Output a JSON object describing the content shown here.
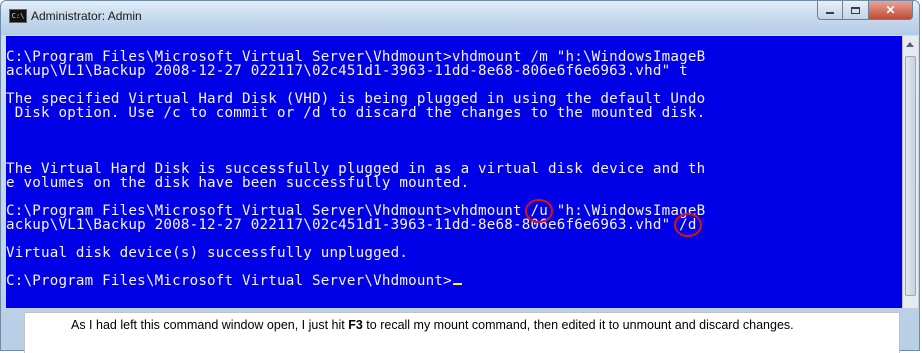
{
  "window": {
    "title": "Administrator: Admin",
    "app_icon_text": "C:\\"
  },
  "console": {
    "lines": [
      "",
      "C:\\Program Files\\Microsoft Virtual Server\\Vhdmount>vhdmount /m \"h:\\WindowsImageB",
      "ackup\\VL1\\Backup 2008-12-27 022117\\02c451d1-3963-11dd-8e68-806e6f6e6963.vhd\" t",
      "",
      "The specified Virtual Hard Disk (VHD) is being plugged in using the default Undo",
      " Disk option. Use /c to commit or /d to discard the changes to the mounted disk.",
      "",
      "",
      "",
      "The Virtual Hard Disk is successfully plugged in as a virtual disk device and th",
      "e volumes on the disk have been successfully mounted.",
      "",
      "C:\\Program Files\\Microsoft Virtual Server\\Vhdmount>vhdmount /u \"h:\\WindowsImageB",
      "ackup\\VL1\\Backup 2008-12-27 022117\\02c451d1-3963-11dd-8e68-806e6f6e6963.vhd\" /d",
      "",
      "Virtual disk device(s) successfully unplugged.",
      "",
      "C:\\Program Files\\Microsoft Virtual Server\\Vhdmount>"
    ],
    "background": "#0000e6",
    "foreground": "#f4f4f4",
    "cursor_color": "#ffff00",
    "highlight_color": "#e01010"
  },
  "caption": {
    "before": "As I had left this command window open, I just hit ",
    "key": "F3",
    "after": " to recall my mount command, then edited it to unmount and discard changes."
  }
}
